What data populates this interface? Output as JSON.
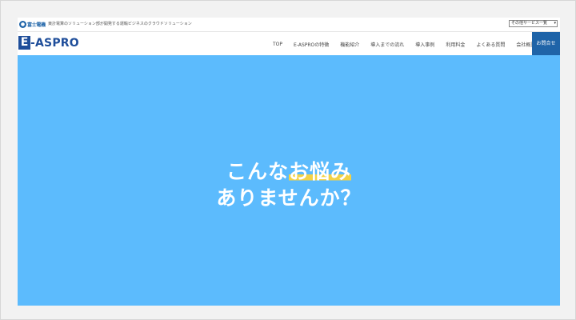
{
  "topbar": {
    "corp_logo_text": "富士電機",
    "tagline": "東計電算のソリューション部が開発する運輸ビジネスのクラウドソリューション",
    "services_select": "その他サービス一覧"
  },
  "header": {
    "brand": "E-ASPRO",
    "nav": [
      "TOP",
      "E-ASPROの特徴",
      "機能紹介",
      "導入までの流れ",
      "導入事例",
      "利用料金",
      "よくある質問",
      "会社概要"
    ],
    "contact": "お問合せ"
  },
  "hero": {
    "line1_pre": "こんな",
    "line1_highlight": "お悩み",
    "line2": "ありませんか？"
  },
  "colors": {
    "hero_bg": "#5cbbfd",
    "brand_blue": "#1f4e9a",
    "contact_bg": "#1f64a8",
    "highlight": "#f3d247"
  }
}
